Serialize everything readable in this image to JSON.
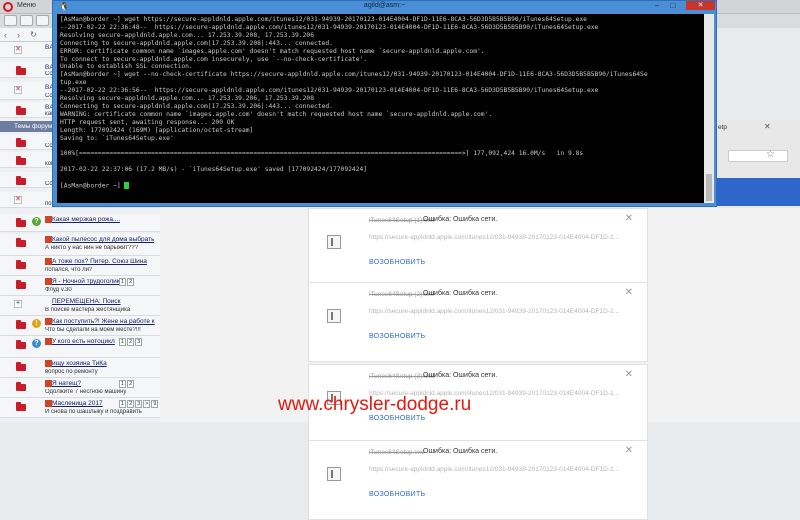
{
  "opera": {
    "menu_label": "Меню"
  },
  "forum": {
    "themes_header": "Темы форум",
    "rows": [
      {
        "title": "BA",
        "sub": ""
      },
      {
        "title": "BA",
        "sub": "Со"
      },
      {
        "title": "BA",
        "sub": "Со"
      },
      {
        "title": "BA",
        "sub": "кам"
      },
      {
        "title": "",
        "sub": "Со"
      },
      {
        "title": "",
        "sub": "ком"
      },
      {
        "title": "",
        "sub": "Соб"
      },
      {
        "title": "",
        "sub": "поиск жестянщика"
      },
      {
        "title": "Какая мерзкая рожа....",
        "sub": ""
      },
      {
        "title": "Какой пылесос для дома выбрать",
        "sub": "А никто у нас нин не барыжит???"
      },
      {
        "title": "А тоже пох? Питер. Союз Шина",
        "sub": "попался, что ли?"
      },
      {
        "title": "Я - Ночной трудоголик",
        "sub": "Флуд v.30",
        "pages": [
          "1",
          "2"
        ]
      },
      {
        "title": "ПЕРЕМЕЩЕНА: Поиск",
        "sub": "В поиске мастера жестянщика"
      },
      {
        "title": "Как поступить?! Жене на работе к",
        "sub": "Что бы сделали на моем месте?!!!"
      },
      {
        "title": "У кого есть нотоцикл",
        "sub": "",
        "pages": [
          "1",
          "2",
          "3"
        ]
      },
      {
        "title": "ищу хозяина ТиКа",
        "sub": "вопрос по ремонту"
      },
      {
        "title": "Я натещ?",
        "sub": "Одолжите 7 несгною машину",
        "pages": [
          "1",
          "2"
        ]
      },
      {
        "title": "Масленица 2017",
        "sub": "И снова по шашлыку и поздравить",
        "pages": [
          "1",
          "2",
          "3",
          ">",
          "9"
        ]
      }
    ]
  },
  "downloads": {
    "items": [
      {
        "filename": "iTunes64Setup (1).exe",
        "error": "Ошибка: Ошибка сети.",
        "url": "https://secure-appldnld.apple.com/itunes12/031-94939-20170123-014E4004-DF1D-1...",
        "resume": "ВОЗОБНОВИТЬ"
      },
      {
        "filename": "iTunes64Setup (2).exe",
        "error": "Ошибка: Ошибка сети.",
        "url": "https://secure-appldnld.apple.com/itunes12/031-94939-20170123-014E4004-DF1D-1...",
        "resume": "ВОЗОБНОВИТЬ"
      },
      {
        "filename": "iTunes64Setup (3).exe",
        "error": "Ошибка: Ошибка сети.",
        "url": "https://secure-appldnld.apple.com/itunes12/031-94939-20170123-014E4004-DF1D-1...",
        "resume": "ВОЗОБНОВИТЬ"
      },
      {
        "filename": "iTunes64Setup.exe",
        "error": "Ошибка: Ошибка сети.",
        "url": "https://secure-appldnld.apple.com/itunes12/031-94939-20170123-014E4004-DF1D-1...",
        "resume": "ВОЗОБНОВИТЬ"
      }
    ],
    "side_tab_label": "etp"
  },
  "terminal": {
    "title": "agild@asm:~",
    "lines": [
      "[AsMan@border ~] wget https://secure-appldnld.apple.com/itunes12/031-94939-20170123-014E4004-DF1D-11E6-8CA3-56D3D5B5B5B90/iTunes64Setup.exe",
      "--2017-02-22 22:36:48--  https://secure-appldnld.apple.com/itunes12/031-94939-20170123-014E4004-DF1D-11E6-8CA3-56D3D5B5B5B90/iTunes64Setup.exe",
      "Resolving secure-appldnld.apple.com... 17.253.39.208, 17.253.39.206",
      "Connecting to secure-appldnld.apple.com|17.253.39.208|:443... connected.",
      "ERROR: certificate common name `images.apple.com' doesn't match requested host name `secure-appldnld.apple.com'.",
      "To connect to secure-appldnld.apple.com insecurely, use `--no-check-certificate'.",
      "Unable to establish SSL connection.",
      "[AsMan@border ~] wget --no-check-certificate https://secure-appldnld.apple.com/itunes12/031-94939-20170123-014E4004-DF1D-11E6-8CA3-56D3D5B5B5B90/iTunes64Se",
      "tup.exe",
      "--2017-02-22 22:36:56--  https://secure-appldnld.apple.com/itunes12/031-94939-20170123-014E4004-DF1D-11E6-8CA3-56D3D5B5B5B90/iTunes64Setup.exe",
      "Resolving secure-appldnld.apple.com... 17.253.39.206, 17.253.39.208",
      "Connecting to secure-appldnld.apple.com|17.253.39.206|:443... connected.",
      "WARNING: certificate common name `images.apple.com' doesn't match requested host name `secure-appldnld.apple.com'.",
      "HTTP request sent, awaiting response... 200 OK",
      "Length: 177092424 (169M) [application/octet-stream]",
      "Saving to: `iTunes64Setup.exe'",
      "",
      "100%[=====================================================================================================>] 177,092,424 16.0M/s   in 9.8s",
      "",
      "2017-02-22 22:37:06 (17.2 MB/s) - `iTunes64Setup.exe' saved [177092424/177092424]",
      ""
    ],
    "prompt": "[AsMan@border ~] "
  },
  "watermark": "www.chrysler-dodge.ru"
}
